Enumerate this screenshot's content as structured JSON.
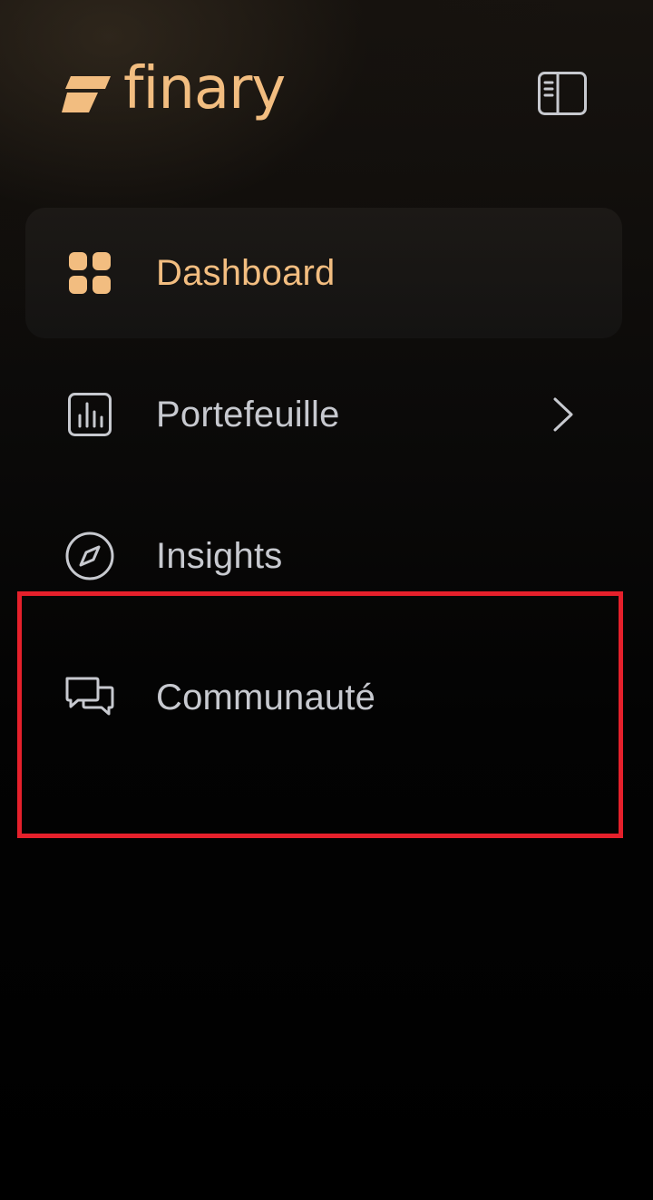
{
  "brand": {
    "name": "finary",
    "color": "#f2bd80"
  },
  "header": {
    "toggle_icon": "sidebar-toggle-icon"
  },
  "nav": {
    "items": [
      {
        "label": "Dashboard",
        "icon": "grid-icon",
        "active": true
      },
      {
        "label": "Portefeuille",
        "icon": "bar-chart-icon",
        "active": false,
        "has_chevron": true
      },
      {
        "label": "Insights",
        "icon": "compass-icon",
        "active": false
      },
      {
        "label": "Communauté",
        "icon": "chat-bubbles-icon",
        "active": false
      }
    ]
  },
  "colors": {
    "accent": "#f2bd80",
    "text": "#c7c9cf",
    "highlight": "#e5202b",
    "background": "#000000"
  }
}
